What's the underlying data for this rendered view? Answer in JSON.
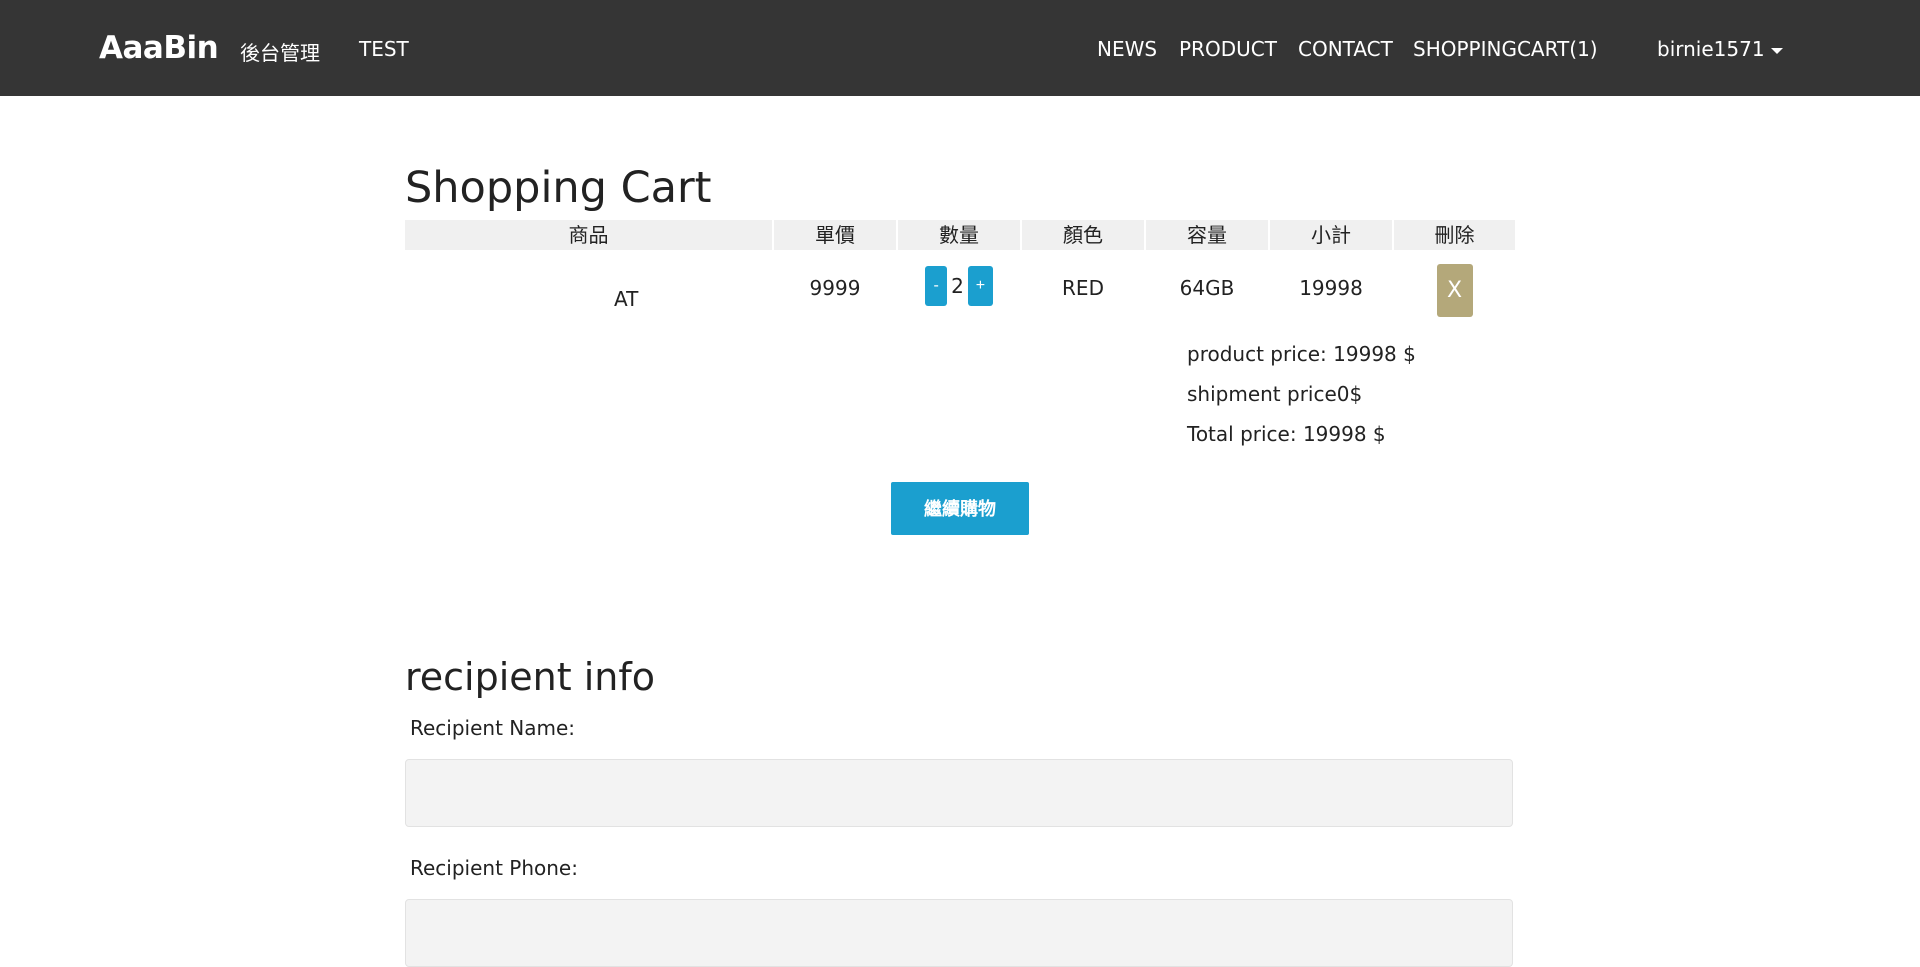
{
  "navbar": {
    "brand": "AaaBin",
    "left_links": [
      "後台管理",
      "TEST"
    ],
    "right_links": [
      "NEWS",
      "PRODUCT",
      "CONTACT",
      "SHOPPINGCART(1)"
    ],
    "user": "birnie1571",
    "background": "#353535"
  },
  "cart": {
    "title": "Shopping Cart",
    "headers": [
      "商品",
      "單價",
      "數量",
      "顏色",
      "容量",
      "小計",
      "刪除"
    ],
    "items": [
      {
        "product": "AT",
        "price": "9999",
        "quantity": "2",
        "minus_label": "-",
        "plus_label": "+",
        "color": "RED",
        "capacity": "64GB",
        "subtotal": "19998",
        "delete_label": "X"
      }
    ],
    "summary": {
      "product_price": "product price: 19998 $",
      "shipment_price": "shipment price0$",
      "total_price": "Total price: 19998 $"
    },
    "continue_label": "繼續購物",
    "accent_color": "#1b9fcf",
    "delete_color": "#b4a87a"
  },
  "recipient": {
    "title": "recipient info",
    "name_label": "Recipient Name:",
    "name_value": "",
    "phone_label": "Recipient Phone:",
    "phone_value": ""
  }
}
